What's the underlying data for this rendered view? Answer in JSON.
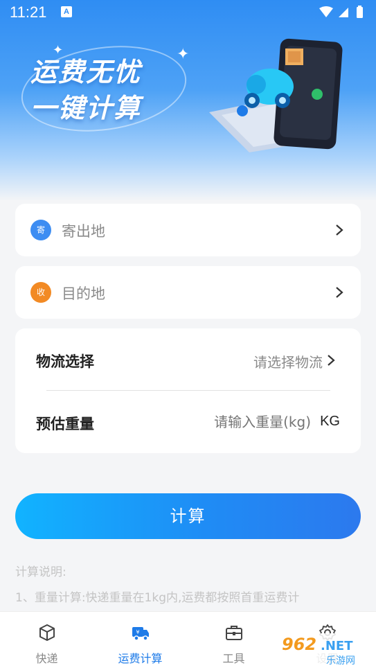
{
  "status_bar": {
    "time": "11:21",
    "notification_glyph": "A"
  },
  "banner": {
    "line1": "运费无忧",
    "line2": "一键计算"
  },
  "origin": {
    "badge": "寄",
    "placeholder": "寄出地",
    "badge_color": "#3d8df2"
  },
  "destination": {
    "badge": "收",
    "placeholder": "目的地",
    "badge_color": "#f28a24"
  },
  "logistics": {
    "label": "物流选择",
    "placeholder": "请选择物流"
  },
  "weight": {
    "label": "预估重量",
    "placeholder": "请输入重量(kg)",
    "unit": "KG"
  },
  "calculate_button": "计算",
  "notes": {
    "title": "计算说明:",
    "line1": "1、重量计算:快递重量在1kg内,运费都按照首重运费计"
  },
  "tabs": [
    {
      "label": "快递",
      "icon": "package-icon",
      "active": false
    },
    {
      "label": "运费计算",
      "icon": "delivery-truck-icon",
      "active": true
    },
    {
      "label": "工具",
      "icon": "toolbox-icon",
      "active": false
    },
    {
      "label": "设置",
      "icon": "gear-icon",
      "active": false
    }
  ],
  "watermark": {
    "brand": "962.NET",
    "subtitle": "乐游网"
  },
  "colors": {
    "accent": "#1e7be8",
    "button_start": "#11b3ff",
    "button_end": "#2c79ee"
  }
}
